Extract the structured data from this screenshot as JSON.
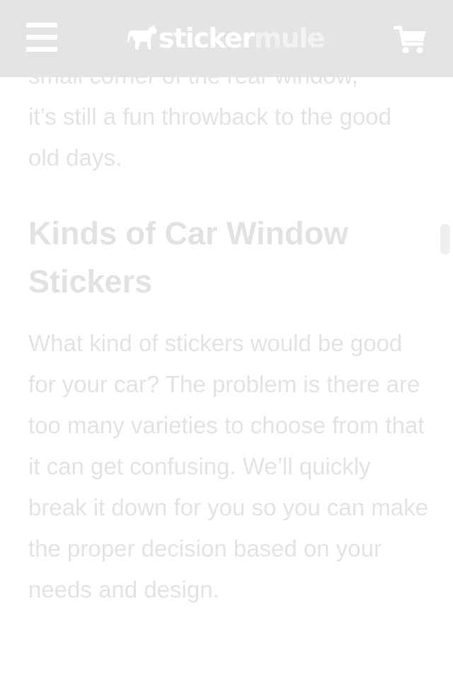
{
  "header": {
    "logo_part1": "sticker",
    "logo_part2": "mule",
    "menu_icon": "hamburger-menu-icon",
    "cart_icon": "shopping-cart-icon",
    "background": "#e4e4e4"
  },
  "article": {
    "intro_cut_line": "small corner of the rear window,",
    "intro_line": "it’s still a fun throwback to the good old days.",
    "heading": "Kinds of Car Window Stickers",
    "paragraph": "What kind of stickers would be good for your car? The problem is there are too many varieties to choose from that it can get confusing. We’ll quickly break it down for you so you can make the proper decision based on your needs and design."
  },
  "colors": {
    "text": "#e3e3e3",
    "header_bg": "#e4e4e4",
    "icons": "#ffffff"
  }
}
